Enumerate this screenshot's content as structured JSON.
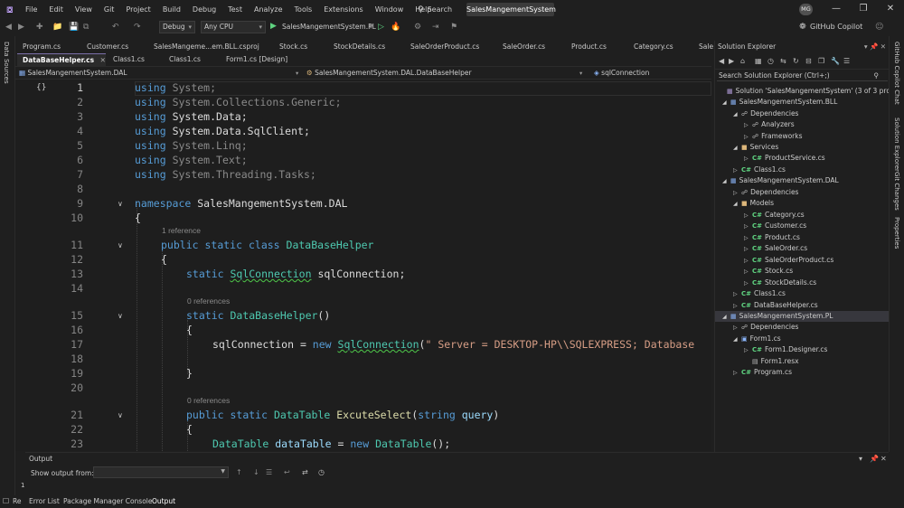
{
  "menubar": {
    "items": [
      "File",
      "Edit",
      "View",
      "Git",
      "Project",
      "Build",
      "Debug",
      "Test",
      "Analyze",
      "Tools",
      "Extensions",
      "Window",
      "Help"
    ],
    "search_label": "Search",
    "solution_name": "SalesMangementSystem",
    "avatar_initials": "MG"
  },
  "toolbar": {
    "config": "Debug",
    "platform": "Any CPU",
    "startup_project": "SalesMangementSystem.PL",
    "copilot": "GitHub Copilot"
  },
  "left_rail": {
    "label": "Data Sources"
  },
  "tabs_row1": [
    "Program.cs",
    "Customer.cs",
    "SalesMangeme...em.BLL.csproj",
    "Stock.cs",
    "StockDetails.cs",
    "SaleOrderProduct.cs",
    "SaleOrder.cs",
    "Product.cs",
    "Category.cs",
    "Sale"
  ],
  "tabs_row2": [
    "DataBaseHelper.cs",
    "Class1.cs",
    "Class1.cs",
    "Form1.cs [Design]"
  ],
  "navbar": {
    "project": "SalesMangementSystem.DAL",
    "type": "SalesMangementSystem.DAL.DataBaseHelper",
    "member": "sqlConnection"
  },
  "editor": {
    "line_numbers": [
      "1",
      "2",
      "3",
      "4",
      "5",
      "6",
      "7",
      "8",
      "9",
      "10",
      "11",
      "12",
      "13",
      "14",
      "15",
      "16",
      "17",
      "18",
      "19",
      "20",
      "21",
      "22",
      "23"
    ],
    "usings": [
      "System",
      "System.Collections.Generic",
      "System.Data",
      "System.Data.SqlClient",
      "System.Linq",
      "System.Text",
      "System.Threading.Tasks"
    ],
    "kw_using": "using",
    "kw_namespace": "namespace",
    "namespace_name": "SalesMangementSystem.DAL",
    "open_brace": "{",
    "close_brace": "}",
    "lens_1_reference": "1 reference",
    "lens_0_references": "0 references",
    "kw_public": "public",
    "kw_static": "static",
    "kw_class": "class",
    "kw_new": "new",
    "kw_string": "string",
    "class_name": "DataBaseHelper",
    "type_sqlconnection": "SqlConnection",
    "field_name": "sqlConnection",
    "semicolon": ";",
    "ctor_parens": "()",
    "assign": " = ",
    "conn_string": "\" Server = DESKTOP-HP\\\\SQLEXPRESS; Database",
    "type_datatable": "DataTable",
    "method_name": "ExcuteSelect",
    "param_name": "query",
    "local_name": "dataTable",
    "ctor_call_end": "();"
  },
  "solution_explorer": {
    "title": "Solution Explorer",
    "search_placeholder": "Search Solution Explorer (Ctrl+;)",
    "nodes": [
      {
        "label": "Solution 'SalesMangementSystem' (3 of 3 projects)",
        "icon": "solution"
      },
      {
        "label": "SalesMangementSystem.BLL",
        "icon": "project"
      },
      {
        "label": "Dependencies",
        "icon": "dependency"
      },
      {
        "label": "Analyzers",
        "icon": "dependency"
      },
      {
        "label": "Frameworks",
        "icon": "dependency"
      },
      {
        "label": "Services",
        "icon": "folder"
      },
      {
        "label": "ProductService.cs",
        "icon": "csharp"
      },
      {
        "label": "Class1.cs",
        "icon": "csharp"
      },
      {
        "label": "SalesMangementSystem.DAL",
        "icon": "project"
      },
      {
        "label": "Dependencies",
        "icon": "dependency"
      },
      {
        "label": "Models",
        "icon": "folder"
      },
      {
        "label": "Category.cs",
        "icon": "csharp"
      },
      {
        "label": "Customer.cs",
        "icon": "csharp"
      },
      {
        "label": "Product.cs",
        "icon": "csharp"
      },
      {
        "label": "SaleOrder.cs",
        "icon": "csharp"
      },
      {
        "label": "SaleOrderProduct.cs",
        "icon": "csharp"
      },
      {
        "label": "Stock.cs",
        "icon": "csharp"
      },
      {
        "label": "StockDetails.cs",
        "icon": "csharp"
      },
      {
        "label": "Class1.cs",
        "icon": "csharp"
      },
      {
        "label": "DataBaseHelper.cs",
        "icon": "csharp"
      },
      {
        "label": "SalesMangementSystem.PL",
        "icon": "project"
      },
      {
        "label": "Dependencies",
        "icon": "dependency"
      },
      {
        "label": "Form1.cs",
        "icon": "form"
      },
      {
        "label": "Form1.Designer.cs",
        "icon": "csharp"
      },
      {
        "label": "Form1.resx",
        "icon": "resx"
      },
      {
        "label": "Program.cs",
        "icon": "csharp"
      }
    ]
  },
  "right_rail": [
    "GitHub Copilot Chat",
    "Solution Explorer",
    "Git Changes",
    "Properties"
  ],
  "output": {
    "title": "Output",
    "show_output_from": "Show output from:"
  },
  "bottom_tabs": [
    "Error List",
    "Package Manager Console",
    "Output"
  ],
  "status": {
    "left_text": "Re",
    "left_sub": "1"
  },
  "colors": {
    "keyword": "#569cd6",
    "type": "#4ec9b0",
    "method": "#dcdcaa",
    "string": "#d69d85",
    "accent": "#7a6ea8"
  }
}
